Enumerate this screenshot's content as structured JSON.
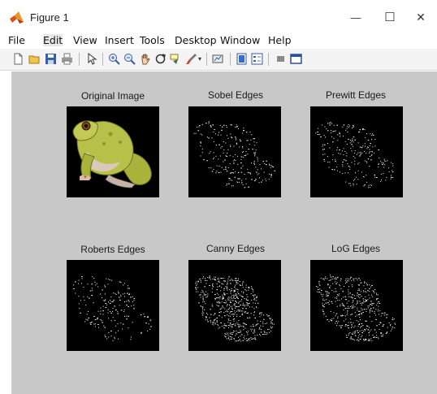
{
  "window": {
    "title": "Figure 1",
    "controls": {
      "minimize": "—",
      "maximize": "☐",
      "close": "✕"
    }
  },
  "menu": {
    "items": [
      "File",
      "Edit",
      "View",
      "Insert",
      "Tools",
      "Desktop",
      "Window",
      "Help"
    ],
    "active": "Edit"
  },
  "toolbar": {
    "icons": [
      "new-figure-icon",
      "open-file-icon",
      "save-icon",
      "print-icon",
      "pointer-icon",
      "zoom-in-icon",
      "zoom-out-icon",
      "pan-icon",
      "rotate-icon",
      "data-cursor-icon",
      "brush-icon",
      "link-plot-icon",
      "colorbar-icon",
      "legend-icon",
      "hide-plot-tools-icon",
      "show-plot-tools-icon"
    ]
  },
  "panels": [
    {
      "title": "Original Image"
    },
    {
      "title": "Sobel Edges"
    },
    {
      "title": "Prewitt Edges"
    },
    {
      "title": "Roberts Edges"
    },
    {
      "title": "Canny Edges"
    },
    {
      "title": "LoG Edges"
    }
  ],
  "colors": {
    "figure_background": "#c8c8c8",
    "image_background": "#000000",
    "edge_pixels": "#ffffff",
    "frog_body": "#b8c04a"
  }
}
